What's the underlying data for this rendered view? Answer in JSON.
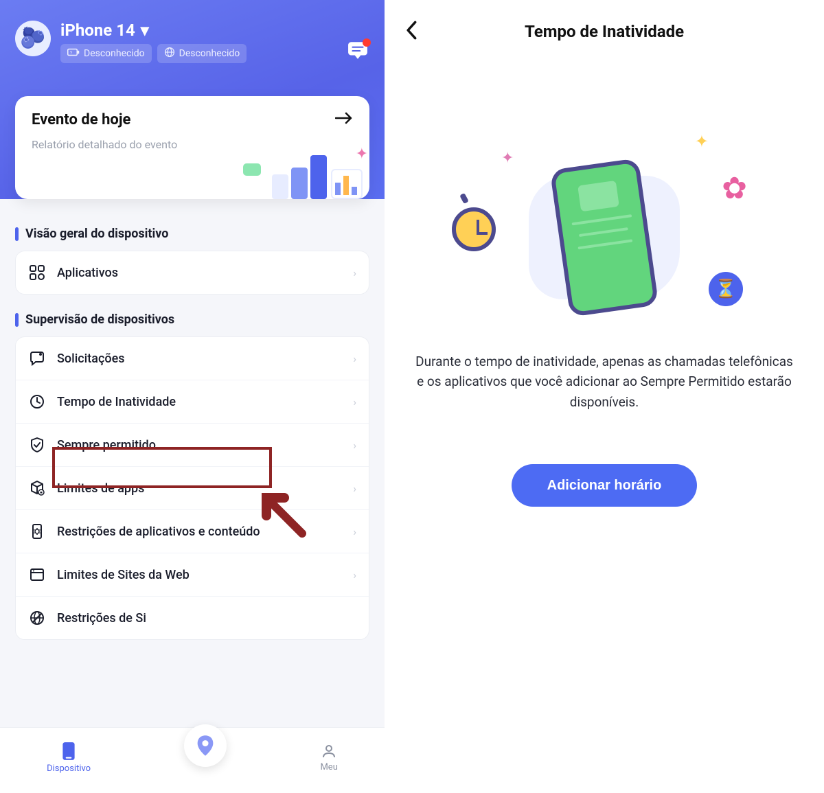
{
  "left": {
    "device_name": "iPhone 14",
    "status": {
      "battery": "Desconhecido",
      "network": "Desconhecido"
    },
    "event": {
      "title": "Evento de hoje",
      "subtitle": "Relatório detalhado do evento"
    },
    "sections": {
      "overview_title": "Visão geral do dispositivo",
      "supervision_title": "Supervisão de dispositivos"
    },
    "overview_items": [
      {
        "label": "Aplicativos",
        "icon": "grid-icon"
      }
    ],
    "supervision_items": [
      {
        "label": "Solicitações",
        "icon": "requests-icon"
      },
      {
        "label": "Tempo de Inatividade",
        "icon": "clock-icon",
        "highlighted": true
      },
      {
        "label": "Sempre permitido",
        "icon": "shield-check-icon"
      },
      {
        "label": "Limites de apps",
        "icon": "cube-lock-icon"
      },
      {
        "label": "Restrições de aplicativos e conteúdo",
        "icon": "phone-gear-icon"
      },
      {
        "label": "Limites de Sites da Web",
        "icon": "browser-icon"
      },
      {
        "label": "Restrições de Si",
        "icon": "globe-block-icon",
        "truncated": true
      }
    ],
    "tabs": {
      "device": "Dispositivo",
      "me": "Meu"
    }
  },
  "right": {
    "title": "Tempo de Inatividade",
    "description": "Durante o tempo de inatividade, apenas as chamadas telefônicas e os aplicativos que você adicionar ao Sempre Permitido estarão disponíveis.",
    "cta_label": "Adicionar horário"
  }
}
